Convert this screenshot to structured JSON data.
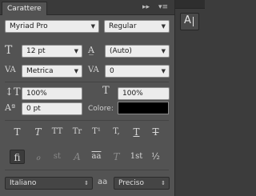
{
  "panel": {
    "tab_title": "Carattere",
    "collapse_icon": "double-arrow-icon",
    "menu_icon": "panel-menu-icon"
  },
  "font": {
    "family": "Myriad Pro",
    "style": "Regular"
  },
  "size": {
    "value": "12 pt",
    "leading": "(Auto)"
  },
  "kerning": {
    "value": "Metrica",
    "tracking": "0"
  },
  "scale": {
    "vertical": "100%",
    "horizontal": "100%"
  },
  "baseline": {
    "shift": "0 pt",
    "color_label": "Colore:",
    "color": "#000000"
  },
  "style_buttons": [
    "T",
    "T",
    "TT",
    "Tr",
    "T¹",
    "T,",
    "T",
    "T"
  ],
  "opentype_buttons": [
    "ﬁ",
    "ℴ",
    "st",
    "A",
    "aa",
    "T",
    "1st",
    "½"
  ],
  "footer": {
    "language": "Italiano",
    "aa_label": "aa",
    "antialias": "Preciso"
  },
  "side_panel": {
    "button_glyph": "A"
  }
}
